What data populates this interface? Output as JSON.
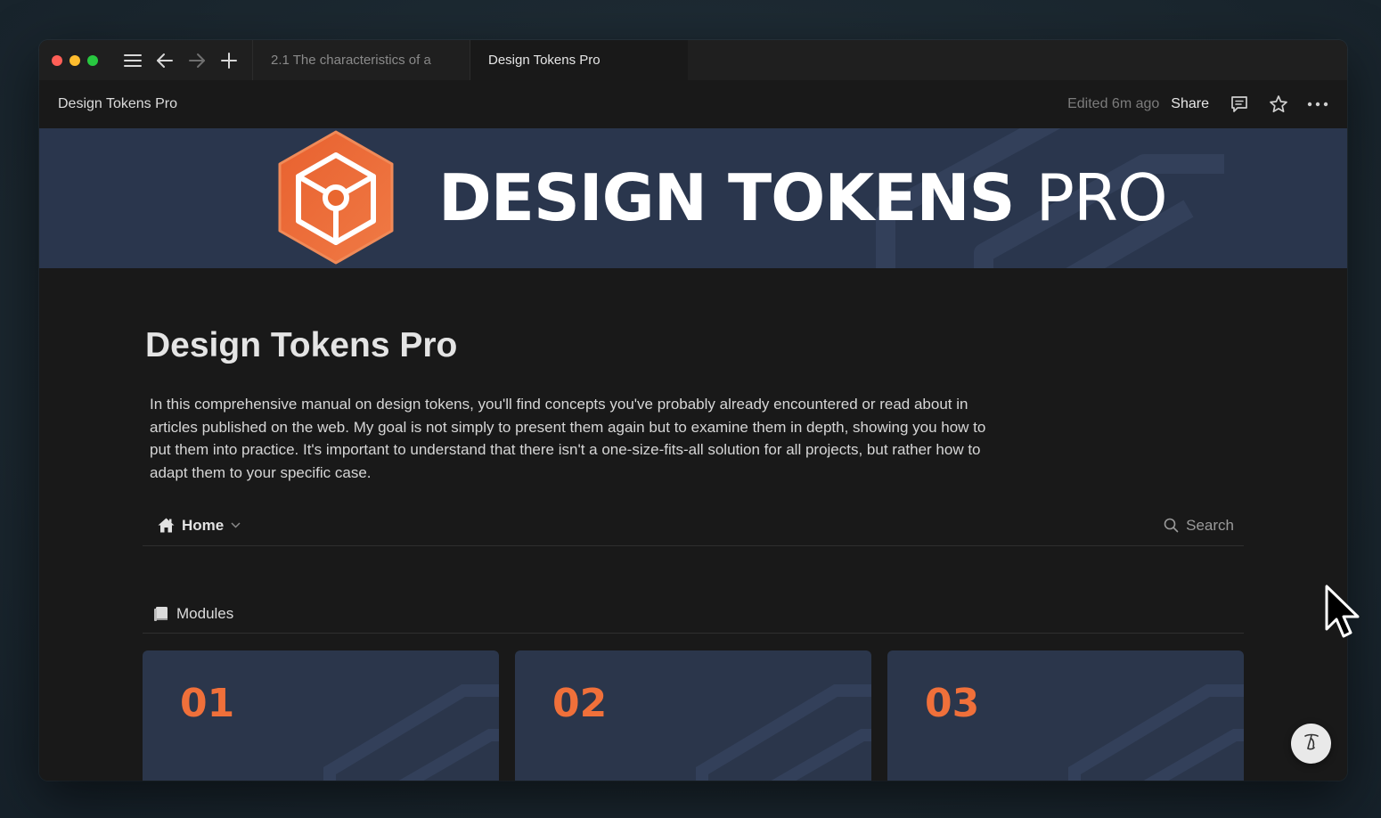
{
  "tabs": [
    {
      "label": "2.1 The characteristics of a",
      "active": false
    },
    {
      "label": "Design Tokens Pro",
      "active": true
    }
  ],
  "header": {
    "breadcrumb": "Design Tokens Pro",
    "edited": "Edited 6m ago",
    "share_label": "Share"
  },
  "banner": {
    "title_bold": "DESIGN TOKENS",
    "title_light": "PRO"
  },
  "page": {
    "title": "Design Tokens Pro",
    "intro": "In this comprehensive manual on design tokens, you'll find concepts you've probably already encountered or read about in articles published on the web. My goal is not simply to present them again but to examine them in depth, showing you how to put them into practice. It's important to understand that there isn't a one-size-fits-all solution for all projects, but rather how to adapt them to your specific case."
  },
  "nav": {
    "home_label": "Home",
    "search_label": "Search"
  },
  "modules": {
    "heading": "Modules",
    "cards": [
      {
        "number": "01"
      },
      {
        "number": "02"
      },
      {
        "number": "03"
      }
    ]
  },
  "colors": {
    "accent": "#f0703a",
    "banner_bg": "#2a364d",
    "card_bg": "#2b364b",
    "page_bg": "#191919"
  },
  "icons": {
    "menu": "hamburger-icon",
    "back": "arrow-left-icon",
    "forward": "arrow-right-icon",
    "new_tab": "plus-icon",
    "comment": "comment-icon",
    "favorite": "star-icon",
    "more": "ellipsis-icon",
    "home": "house-icon",
    "search": "search-icon",
    "modules": "book-icon",
    "help": "help-icon"
  }
}
